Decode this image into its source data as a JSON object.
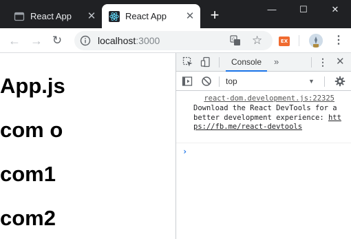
{
  "window": {
    "minimize_glyph": "—",
    "maximize_glyph": "☐",
    "close_glyph": "✕"
  },
  "tabs": [
    {
      "title": "React App",
      "active": false,
      "icon": "page-icon",
      "close_glyph": "✕"
    },
    {
      "title": "React App",
      "active": true,
      "icon": "react-logo-icon",
      "close_glyph": "✕"
    }
  ],
  "new_tab_glyph": "+",
  "toolbar": {
    "back_glyph": "←",
    "forward_glyph": "→",
    "reload_glyph": "↻",
    "url_host": "localhost",
    "url_port": ":3000",
    "star_glyph": "☆",
    "extension_label": "EX",
    "menu_glyph": "⋮"
  },
  "page": {
    "headings": [
      "App.js",
      "com o",
      "com1",
      "com2"
    ]
  },
  "devtools": {
    "active_tab": "Console",
    "more_tabs_glyph": "»",
    "kebab_glyph": "⋮",
    "close_glyph": "✕",
    "context": "top",
    "context_arrow": "▼",
    "message": {
      "source": "react-dom.development.js:22325",
      "text": "Download the React DevTools for a better development experience: ",
      "link": "https://fb.me/react-devtools"
    },
    "prompt": "›"
  },
  "colors": {
    "tabstrip_bg": "#202124",
    "accent": "#1a73e8",
    "react_blue": "#61dafb",
    "extension_orange": "#f06b30"
  }
}
